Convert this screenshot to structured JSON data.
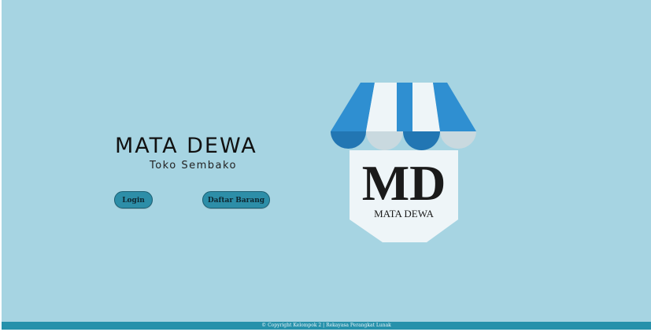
{
  "hero": {
    "title": "MATA DEWA",
    "subtitle": "Toko Sembako"
  },
  "buttons": {
    "login": "Login",
    "items": "Daftar Barang"
  },
  "logo": {
    "monogram": "MD",
    "wordmark": "MATA DEWA"
  },
  "footer": {
    "copyright": "© Copyright Kelompok 2 | Rekayasa Perangkat Lunak"
  },
  "colors": {
    "background": "#a6d4e2",
    "button": "#2d8ea8",
    "footer": "#2691ab",
    "awning_blue": "#2f8fd1",
    "awning_white": "#eef5f8"
  }
}
